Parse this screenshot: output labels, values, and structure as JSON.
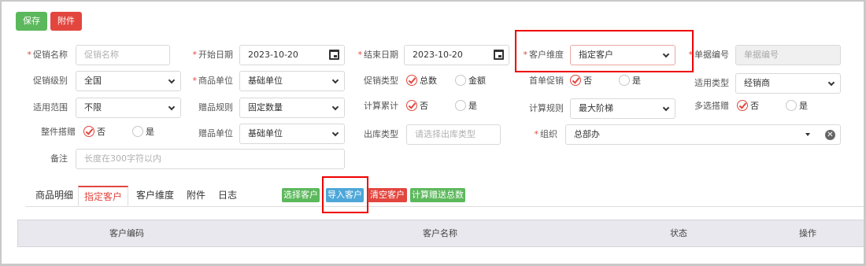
{
  "toolbar": {
    "save_label": "保存",
    "attach_label": "附件"
  },
  "form": {
    "promo_name": {
      "label": "促销名称",
      "placeholder": "促销名称"
    },
    "start_date": {
      "label": "开始日期",
      "value": "2023-10-20"
    },
    "end_date": {
      "label": "结束日期",
      "value": "2023-10-20"
    },
    "customer_dim": {
      "label": "客户维度",
      "value": "指定客户"
    },
    "doc_no": {
      "label": "单据编号",
      "placeholder": "单据编号"
    },
    "promo_level": {
      "label": "促销级别",
      "value": "全国"
    },
    "goods_unit": {
      "label": "商品单位",
      "value": "基础单位"
    },
    "promo_type": {
      "label": "促销类型",
      "opt1": "总数",
      "opt2": "金额"
    },
    "first_promo": {
      "label": "首单促销",
      "opt1": "否",
      "opt2": "是"
    },
    "apply_type": {
      "label": "适用类型",
      "value": "经销商"
    },
    "apply_scope": {
      "label": "适用范围",
      "value": "不限"
    },
    "gift_rule": {
      "label": "赠品规则",
      "value": "固定数量"
    },
    "calc_accum": {
      "label": "计算累计",
      "opt1": "否",
      "opt2": "是"
    },
    "calc_rule": {
      "label": "计算规则",
      "value": "最大阶梯"
    },
    "multi_gift": {
      "label": "多选搭赠",
      "opt1": "否",
      "opt2": "是"
    },
    "whole_gift": {
      "label": "整件搭赠",
      "opt1": "否",
      "opt2": "是"
    },
    "gift_unit": {
      "label": "赠品单位",
      "value": "基础单位"
    },
    "out_type": {
      "label": "出库类型",
      "placeholder": "请选择出库类型"
    },
    "org": {
      "label": "组织",
      "value": "总部办"
    },
    "remark": {
      "label": "备注",
      "placeholder": "长度在300字符以内"
    }
  },
  "tabs": [
    {
      "label": "商品明细"
    },
    {
      "label": "指定客户"
    },
    {
      "label": "客户维度"
    },
    {
      "label": "附件"
    },
    {
      "label": "日志"
    }
  ],
  "actions": {
    "select_customer": "选择客户",
    "import_customer": "导入客户",
    "clear_customer": "清空客户",
    "calc_gift_total": "计算赠送总数"
  },
  "table": {
    "columns": [
      "客户编码",
      "客户名称",
      "状态",
      "操作"
    ]
  },
  "colors": {
    "accent_red": "#e2463f",
    "green": "#5cb85c",
    "blue": "#4da7d8",
    "highlight_box": "#e00000"
  }
}
